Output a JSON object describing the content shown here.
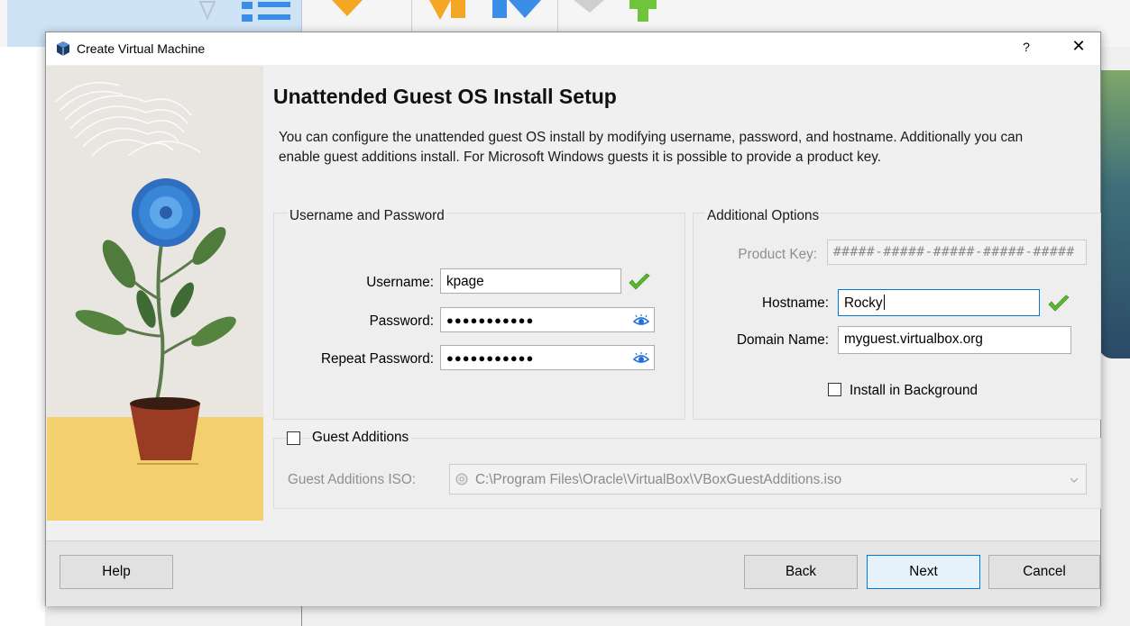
{
  "window": {
    "title": "Create Virtual Machine",
    "help_glyph": "?",
    "close_glyph": "✕"
  },
  "page": {
    "heading": "Unattended Guest OS Install Setup",
    "description": "You can configure the unattended guest OS install by modifying username, password, and hostname. Additionally you can enable guest additions install. For Microsoft Windows guests it is possible to provide a product key."
  },
  "credentials": {
    "group_title": "Username and Password",
    "username_label": "Username:",
    "username_value": "kpage",
    "password_label": "Password:",
    "password_value": "●●●●●●●●●●●",
    "repeat_label": "Repeat Password:",
    "repeat_value": "●●●●●●●●●●●"
  },
  "additional": {
    "group_title": "Additional Options",
    "product_key_label": "Product Key:",
    "product_key_placeholder": "#####-#####-#####-#####-#####",
    "hostname_label": "Hostname:",
    "hostname_value": "Rocky",
    "domain_label": "Domain Name:",
    "domain_value": "myguest.virtualbox.org",
    "install_bg_label": "Install in Background",
    "install_bg_checked": false
  },
  "guest_additions": {
    "label": "Guest Additions",
    "checked": false,
    "iso_label": "Guest Additions ISO:",
    "iso_value": "C:\\Program Files\\Oracle\\VirtualBox\\VBoxGuestAdditions.iso"
  },
  "buttons": {
    "help": "Help",
    "back": "Back",
    "next": "Next",
    "cancel": "Cancel"
  },
  "colors": {
    "accent": "#0078d7",
    "valid_check": "#5cb830",
    "eye_icon": "#1e6fd9"
  },
  "icons": [
    "virtualbox-icon",
    "valid-check-icon",
    "show-password-icon",
    "disc-icon",
    "chevron-down-icon"
  ]
}
